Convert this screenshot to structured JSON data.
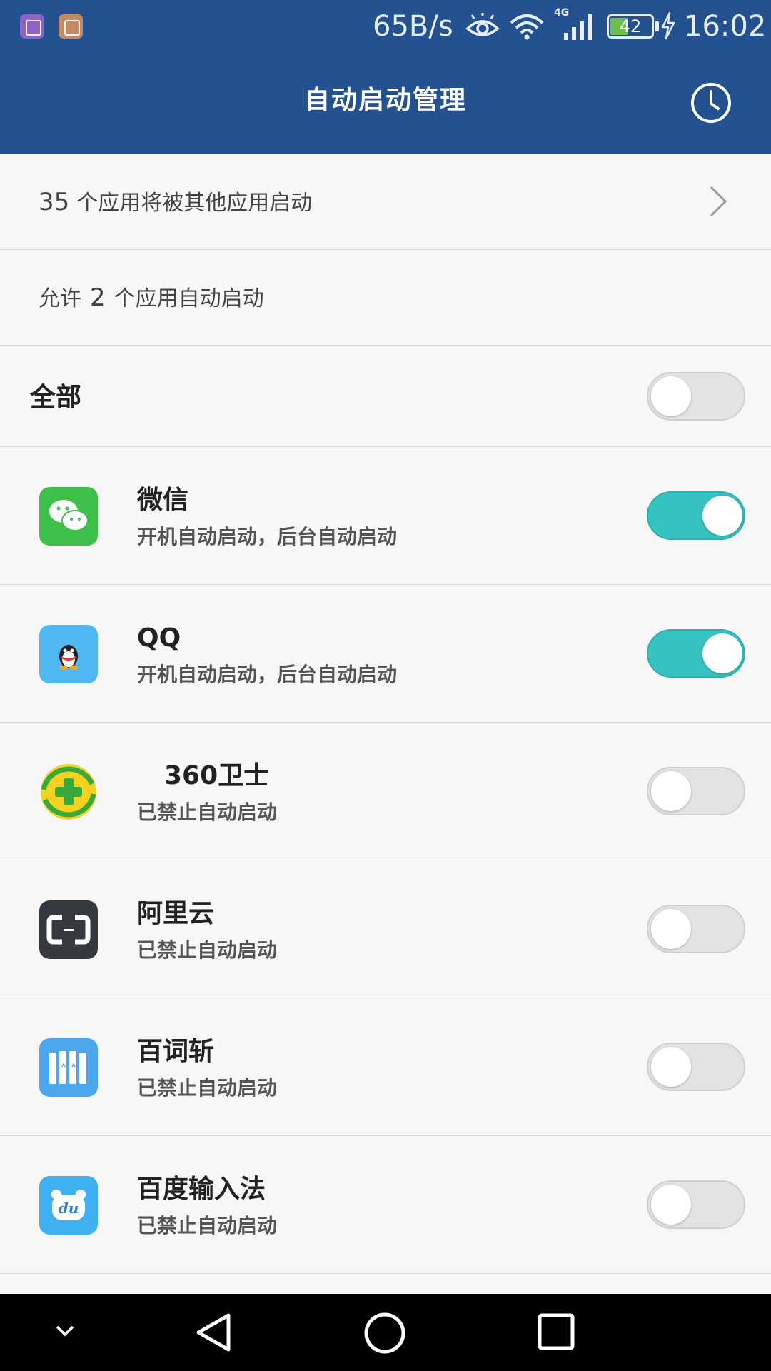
{
  "status_bar": {
    "notification_icons": [
      "gallery-icon",
      "gallery-icon"
    ],
    "net_speed": "65B/s",
    "network_type": "4G",
    "battery_level": "42",
    "battery_fraction": 0.42,
    "time": "16:02"
  },
  "header": {
    "title": "自动启动管理",
    "history_icon": "clock-icon"
  },
  "summary": {
    "count": "35",
    "text": "个应用将被其他应用启动"
  },
  "allowed": {
    "prefix": "允许",
    "count": "2",
    "suffix": "个应用自动启动"
  },
  "all_toggle": {
    "label": "全部",
    "on": false
  },
  "apps": [
    {
      "name": "微信",
      "status": "开机自动启动，后台自动启动",
      "on": true,
      "icon": "wechat-icon"
    },
    {
      "name": "QQ",
      "status": "开机自动启动，后台自动启动",
      "on": true,
      "icon": "qq-icon"
    },
    {
      "name": "360卫士",
      "status": "已禁止自动启动",
      "on": false,
      "icon": "360-icon"
    },
    {
      "name": "阿里云",
      "status": "已禁止自动启动",
      "on": false,
      "icon": "aliyun-icon"
    },
    {
      "name": "百词斩",
      "status": "已禁止自动启动",
      "on": false,
      "icon": "baicizhan-icon"
    },
    {
      "name": "百度输入法",
      "status": "已禁止自动启动",
      "on": false,
      "icon": "baidu-ime-icon"
    }
  ],
  "colors": {
    "header_bg": "#245190",
    "toggle_on": "#35c2c1",
    "toggle_off": "#e3e3e3"
  },
  "nav_bar": {
    "buttons": [
      "chevron-down-icon",
      "back-icon",
      "home-icon",
      "recents-icon"
    ]
  }
}
